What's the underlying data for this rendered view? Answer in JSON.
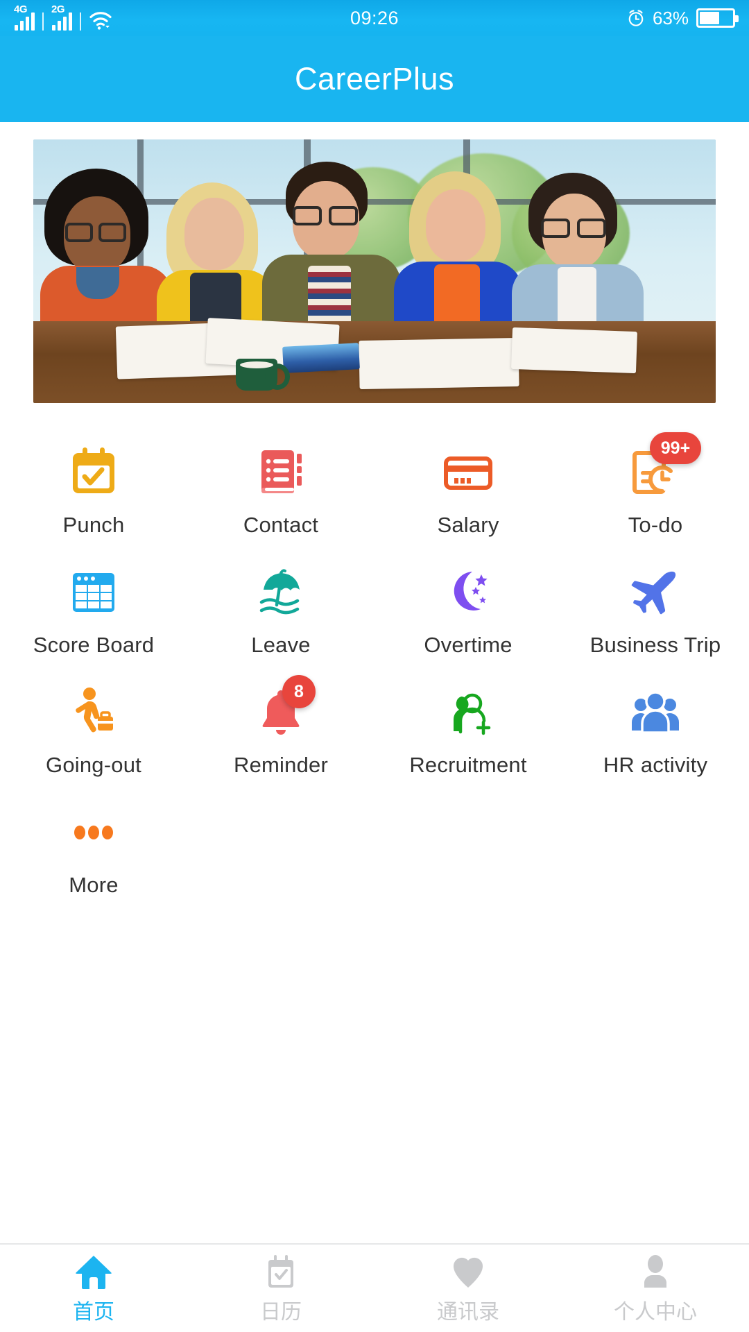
{
  "status_bar": {
    "network_primary": "4G",
    "network_secondary": "2G",
    "wifi_icon": "wifi-icon",
    "time": "09:26",
    "alarm_icon": "alarm-clock-icon",
    "battery_percent": "63%",
    "battery_level": 60
  },
  "header": {
    "title": "CareerPlus",
    "background_color": "#19b5f0"
  },
  "banner": {
    "alt": "team of five smiling colleagues at a table with books"
  },
  "grid": {
    "items": [
      {
        "label": "Punch",
        "icon": "calendar-check-icon",
        "color": "#eeab17",
        "badge": null
      },
      {
        "label": "Contact",
        "icon": "address-book-icon",
        "color": "#ea5a5a",
        "badge": null
      },
      {
        "label": "Salary",
        "icon": "credit-card-icon",
        "color": "#ec5b27",
        "badge": null
      },
      {
        "label": "To-do",
        "icon": "document-clock-icon",
        "color": "#f79a3c",
        "badge": "99+",
        "badge_shape": "pill"
      },
      {
        "label": "Score Board",
        "icon": "table-grid-icon",
        "color": "#22aaee",
        "badge": null
      },
      {
        "label": "Leave",
        "icon": "beach-umbrella-icon",
        "color": "#12a899",
        "badge": null
      },
      {
        "label": "Overtime",
        "icon": "moon-stars-icon",
        "color": "#7e4ef0",
        "badge": null
      },
      {
        "label": "Business Trip",
        "icon": "airplane-icon",
        "color": "#5273e8",
        "badge": null
      },
      {
        "label": "Going-out",
        "icon": "walking-traveler-icon",
        "color": "#f7941e",
        "badge": null
      },
      {
        "label": "Reminder",
        "icon": "bell-icon",
        "color": "#ef5b5b",
        "badge": "8",
        "badge_shape": "dot"
      },
      {
        "label": "Recruitment",
        "icon": "add-person-icon",
        "color": "#17a71f",
        "badge": null
      },
      {
        "label": "HR activity",
        "icon": "people-group-icon",
        "color": "#4b88e0",
        "badge": null
      },
      {
        "label": "More",
        "icon": "ellipsis-icon",
        "color": "#f7791e",
        "badge": null
      }
    ]
  },
  "tab_bar": {
    "tabs": [
      {
        "label": "首页",
        "icon": "home-icon",
        "active": true
      },
      {
        "label": "日历",
        "icon": "calendar-icon",
        "active": false
      },
      {
        "label": "通讯录",
        "icon": "heart-icon",
        "active": false
      },
      {
        "label": "个人中心",
        "icon": "user-profile-icon",
        "active": false
      }
    ],
    "active_color": "#1cb4f0",
    "inactive_color": "#c9cacc"
  }
}
